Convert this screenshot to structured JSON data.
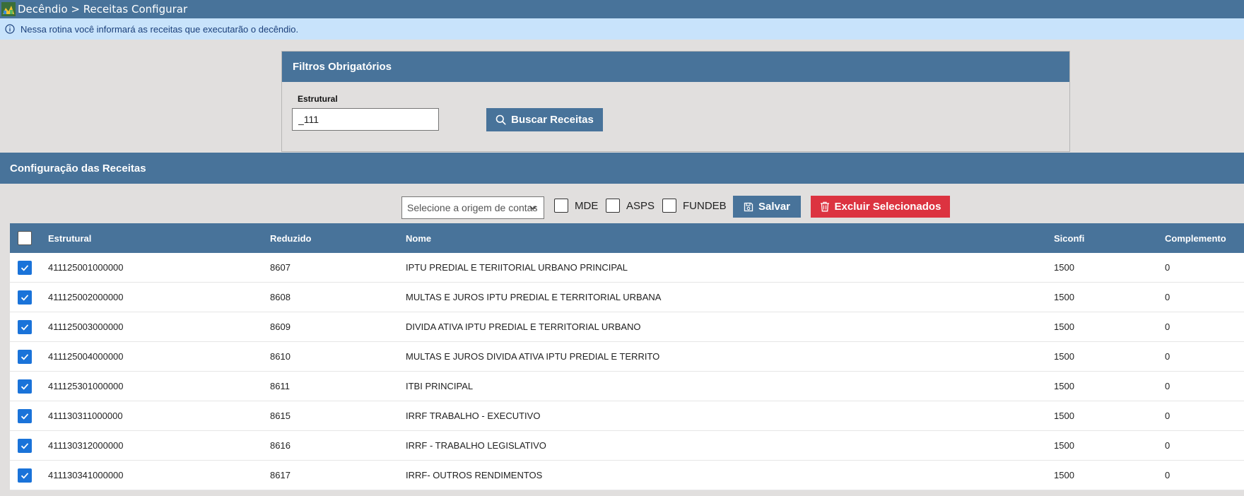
{
  "topbar": {
    "breadcrumb": "Decêndio > Receitas Configurar"
  },
  "info": {
    "message": "Nessa rotina você informará as receitas que executarão o decêndio."
  },
  "filters": {
    "title": "Filtros Obrigatórios",
    "estrutural_label": "Estrutural",
    "estrutural_value": "_111",
    "search_button": "Buscar Receitas"
  },
  "config": {
    "title": "Configuração das Receitas",
    "origin_select": "Selecione a origem de contas",
    "checks": {
      "mde": "MDE",
      "asps": "ASPS",
      "fundeb": "FUNDEB"
    },
    "save_button": "Salvar",
    "delete_button": "Excluir Selecionados"
  },
  "table": {
    "headers": {
      "estrutural": "Estrutural",
      "reduzido": "Reduzido",
      "nome": "Nome",
      "siconfi": "Siconfi",
      "complemento": "Complemento"
    },
    "rows": [
      {
        "estrutural": "411125001000000",
        "reduzido": "8607",
        "nome": "IPTU PREDIAL E TERIITORIAL URBANO PRINCIPAL",
        "siconfi": "1500",
        "complemento": "0",
        "checked": true
      },
      {
        "estrutural": "411125002000000",
        "reduzido": "8608",
        "nome": "MULTAS E JUROS IPTU PREDIAL E TERRITORIAL URBANA",
        "siconfi": "1500",
        "complemento": "0",
        "checked": true
      },
      {
        "estrutural": "411125003000000",
        "reduzido": "8609",
        "nome": "DIVIDA ATIVA IPTU PREDIAL E TERRITORIAL URBANO",
        "siconfi": "1500",
        "complemento": "0",
        "checked": true
      },
      {
        "estrutural": "411125004000000",
        "reduzido": "8610",
        "nome": "MULTAS E JUROS DIVIDA ATIVA IPTU PREDIAL E TERRITO",
        "siconfi": "1500",
        "complemento": "0",
        "checked": true
      },
      {
        "estrutural": "411125301000000",
        "reduzido": "8611",
        "nome": "ITBI PRINCIPAL",
        "siconfi": "1500",
        "complemento": "0",
        "checked": true
      },
      {
        "estrutural": "411130311000000",
        "reduzido": "8615",
        "nome": "IRRF TRABALHO - EXECUTIVO",
        "siconfi": "1500",
        "complemento": "0",
        "checked": true
      },
      {
        "estrutural": "411130312000000",
        "reduzido": "8616",
        "nome": "IRRF - TRABALHO LEGISLATIVO",
        "siconfi": "1500",
        "complemento": "0",
        "checked": true
      },
      {
        "estrutural": "411130341000000",
        "reduzido": "8617",
        "nome": "IRRF- OUTROS RENDIMENTOS",
        "siconfi": "1500",
        "complemento": "0",
        "checked": true
      }
    ]
  }
}
